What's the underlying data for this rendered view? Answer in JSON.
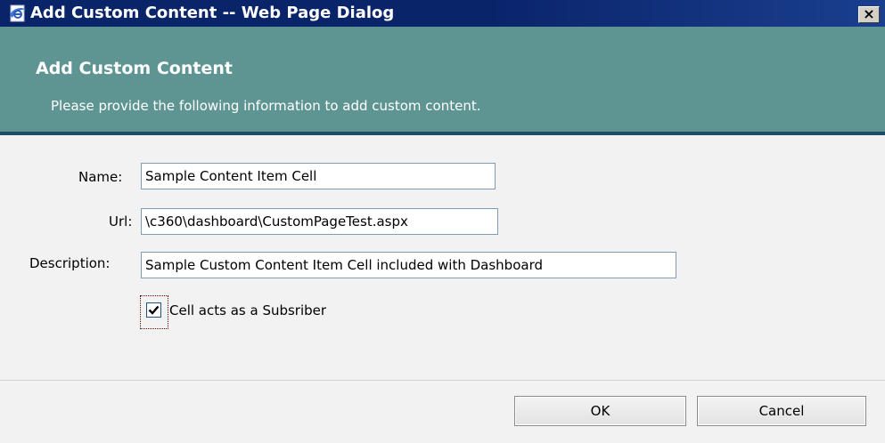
{
  "window": {
    "title": "Add Custom Content -- Web Page Dialog",
    "app_icon": "ie-page-icon",
    "close_glyph": "×"
  },
  "header": {
    "heading": "Add Custom Content",
    "subheading": "Please provide the following information to add custom content.",
    "band_color": "#5e9593",
    "rule_color": "#1e4b66"
  },
  "form": {
    "name": {
      "label": "Name:",
      "value": "Sample Content Item Cell"
    },
    "url": {
      "label": "Url:",
      "value": "\\c360\\dashboard\\CustomPageTest.aspx"
    },
    "description": {
      "label": "Description:",
      "value": "Sample Custom Content Item Cell included with Dashboard"
    },
    "subscriber": {
      "label": "Cell acts as a Subsriber",
      "checked": true
    }
  },
  "buttons": {
    "ok_label": "OK",
    "cancel_label": "Cancel"
  }
}
